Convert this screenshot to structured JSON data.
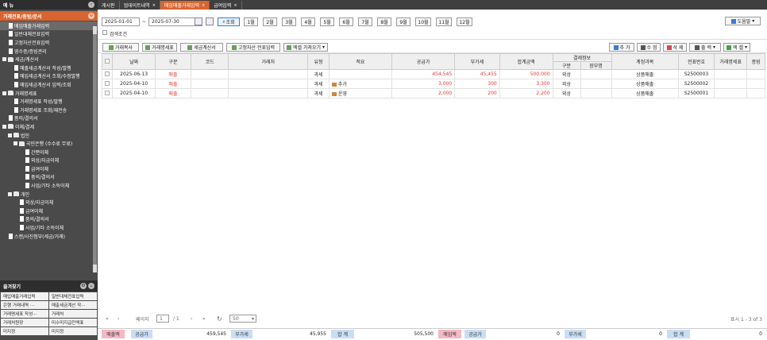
{
  "sidebar": {
    "title": "메 뉴",
    "section": "거래전표/증빙/문서",
    "items": [
      {
        "label": "매입매출거래입력",
        "type": "doc",
        "indent": 1,
        "selected": true
      },
      {
        "label": "일반대체전표입력",
        "type": "doc",
        "indent": 1
      },
      {
        "label": "고정자산전표입력",
        "type": "doc",
        "indent": 1
      },
      {
        "label": "영수증/증빙관리",
        "type": "doc",
        "indent": 1
      },
      {
        "label": "세금/계산서",
        "type": "folder",
        "indent": 0
      },
      {
        "label": "매출세금계산서 작성/발행",
        "type": "doc",
        "indent": 2
      },
      {
        "label": "매입세금계산서 조회/수정발행",
        "type": "doc",
        "indent": 2
      },
      {
        "label": "매입세금계산서 입력/조회",
        "type": "doc",
        "indent": 2
      },
      {
        "label": "거래명세표",
        "type": "folder",
        "indent": 0
      },
      {
        "label": "거래명세표 작성/발행",
        "type": "doc",
        "indent": 2
      },
      {
        "label": "거래명세표 조회/재전송",
        "type": "doc",
        "indent": 2
      },
      {
        "label": "품의/결의서",
        "type": "doc",
        "indent": 1
      },
      {
        "label": "이체/결제",
        "type": "folder",
        "indent": 0
      },
      {
        "label": "법인",
        "type": "folder",
        "indent": 1
      },
      {
        "label": "국민은행 (수수료 무료)",
        "type": "folder",
        "indent": 2
      },
      {
        "label": "간편이체",
        "type": "doc",
        "indent": 4
      },
      {
        "label": "외상/자금이체",
        "type": "doc",
        "indent": 4
      },
      {
        "label": "급여이체",
        "type": "doc",
        "indent": 4
      },
      {
        "label": "품의/결의서",
        "type": "doc",
        "indent": 4
      },
      {
        "label": "사업/기타 소득이체",
        "type": "doc",
        "indent": 4
      },
      {
        "label": "개인",
        "type": "folder",
        "indent": 1
      },
      {
        "label": "외상/자금이체",
        "type": "doc",
        "indent": 3
      },
      {
        "label": "급여이체",
        "type": "doc",
        "indent": 3
      },
      {
        "label": "품의/결의서",
        "type": "doc",
        "indent": 3
      },
      {
        "label": "사업/기타 소득이체",
        "type": "doc",
        "indent": 3
      },
      {
        "label": "스캔/사진첨부(세금/거래)",
        "type": "doc",
        "indent": 1
      }
    ],
    "favorites_title": "즐겨찾기",
    "favorites": [
      "매입매출거래입력",
      "일반대체전표입력",
      "은행 거래내역 ···",
      "매출세금계산 작···",
      "거래명세표 작성···",
      "거래처",
      "거래처원장",
      "미수미지급잔액표",
      "미지정",
      "미지정"
    ]
  },
  "tabs": [
    {
      "label": "게시판",
      "active": false
    },
    {
      "label": "업데이트내역",
      "active": false
    },
    {
      "label": "매입매출거래입력",
      "active": true
    },
    {
      "label": "급여입력",
      "active": false
    }
  ],
  "filter": {
    "date_from": "2025-01-01",
    "date_sep": "~",
    "date_to": "2025-07-30",
    "search_label": "조회",
    "months": [
      "1월",
      "2월",
      "3월",
      "4월",
      "5월",
      "6월",
      "7월",
      "8월",
      "9월",
      "10월",
      "11월",
      "12월"
    ],
    "help_label": "도움말",
    "condition_label": "검색조건"
  },
  "actions": {
    "left": [
      "거래복사",
      "거래명세표",
      "세금계산서",
      "고정자산 전표입력",
      "엑셀 가져오기"
    ],
    "right": [
      "추 가",
      "수 정",
      "삭 제",
      "출 력",
      "엑 셀"
    ]
  },
  "table": {
    "headers": [
      "날짜",
      "구분",
      "코드",
      "거래처",
      "유형",
      "적요",
      "공급가",
      "부가세",
      "합계금액",
      "결제정보",
      "계정과목",
      "전표번호",
      "거래명세표",
      "증빙"
    ],
    "sub_headers": [
      "구분",
      "장부명"
    ],
    "rows": [
      {
        "date": "2025-06-13",
        "kind": "매출",
        "code": "",
        "vendor": "",
        "type": "과세",
        "memo": "",
        "supply": "454,545",
        "vat": "45,455",
        "total": "500,000",
        "pay": "외상",
        "book": "",
        "account": "상품매출",
        "voucher": "S2500003"
      },
      {
        "date": "2025-04-10",
        "kind": "매출",
        "code": "",
        "vendor": "",
        "type": "과세",
        "memo": "추가",
        "supply": "3,000",
        "vat": "300",
        "total": "3,300",
        "pay": "외상",
        "book": "",
        "account": "상품매출",
        "voucher": "S2500002"
      },
      {
        "date": "2025-04-10",
        "kind": "매출",
        "code": "",
        "vendor": "",
        "type": "과세",
        "memo": "운영",
        "supply": "2,000",
        "vat": "200",
        "total": "2,200",
        "pay": "외상",
        "book": "",
        "account": "상품매출",
        "voucher": "S2500001"
      }
    ]
  },
  "pager": {
    "page_label": "페이지",
    "page": "1",
    "of": "/ 1",
    "page_size": "50",
    "summary": "표시 1 - 3 of 3"
  },
  "totals": {
    "sales_label": "매출액",
    "supply_label": "공급가",
    "sales_supply": "459,545",
    "vat_label": "부가세",
    "sales_vat": "45,955",
    "sum_label": "합 계",
    "sales_total": "505,500",
    "purchase_label": "매입액",
    "purchase_supply": "0",
    "purchase_vat": "0",
    "purchase_total": "0"
  },
  "colors": {
    "accent": "#d8652f",
    "sales_red": "#e53935"
  }
}
